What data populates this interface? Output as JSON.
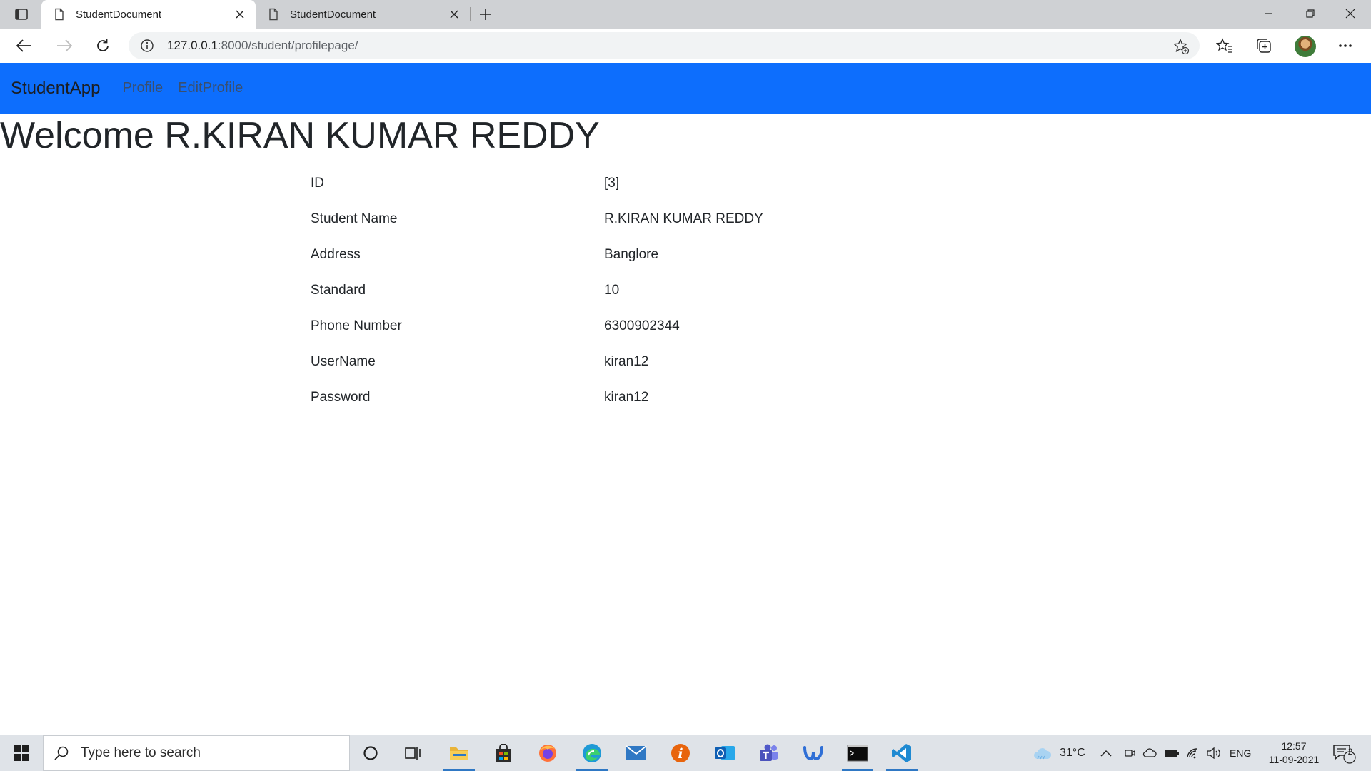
{
  "browser": {
    "tabs": [
      {
        "title": "StudentDocument",
        "active": true
      },
      {
        "title": "StudentDocument",
        "active": false
      }
    ],
    "address": {
      "host": "127.0.0.1",
      "rest": ":8000/student/profilepage/"
    }
  },
  "page": {
    "brand": "StudentApp",
    "nav": [
      {
        "label": "Profile"
      },
      {
        "label": "EditProfile"
      }
    ],
    "welcome": "Welcome R.KIRAN KUMAR REDDY",
    "profile": [
      {
        "label": "ID",
        "value": "[3]"
      },
      {
        "label": "Student Name",
        "value": "R.KIRAN KUMAR REDDY"
      },
      {
        "label": "Address",
        "value": "Banglore"
      },
      {
        "label": "Standard",
        "value": "10"
      },
      {
        "label": "Phone Number",
        "value": "6300902344"
      },
      {
        "label": "UserName",
        "value": "kiran12"
      },
      {
        "label": "Password",
        "value": "kiran12"
      }
    ]
  },
  "taskbar": {
    "search_placeholder": "Type here to search",
    "weather": "31°C",
    "language": "ENG",
    "time": "12:57",
    "date": "11-09-2021",
    "notification_count": "2"
  },
  "colors": {
    "navbar": "#0d6efd",
    "taskbar": "#dfe3e8"
  }
}
